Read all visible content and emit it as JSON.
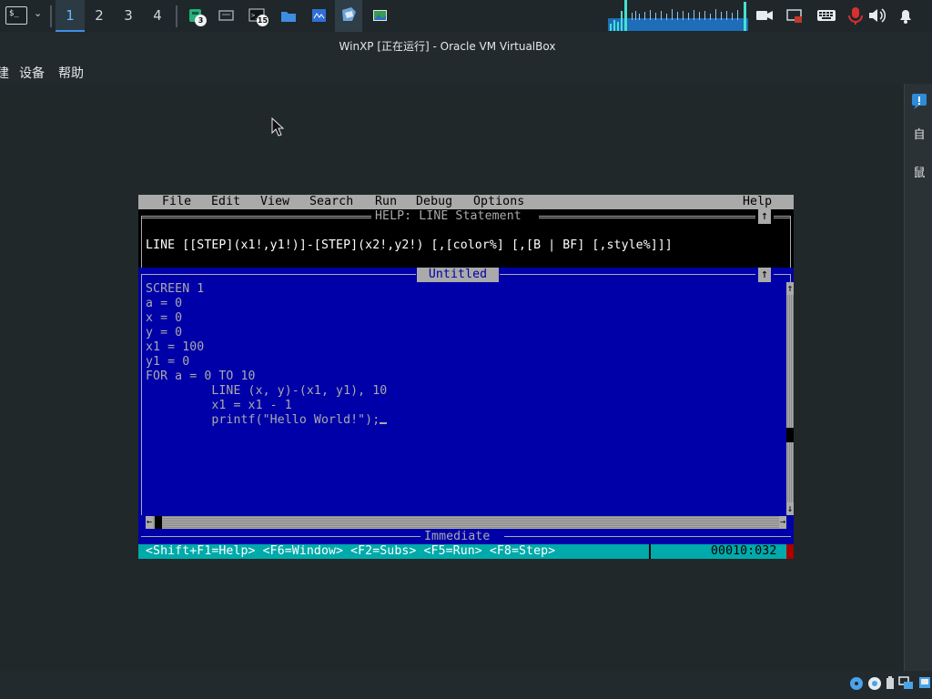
{
  "taskbar": {
    "workspaces": [
      "1",
      "2",
      "3",
      "4"
    ],
    "active_workspace": "1",
    "apps": [
      {
        "icon": "green-tool-icon",
        "badge": "3"
      },
      {
        "icon": "monitor-icon",
        "badge": ""
      },
      {
        "icon": "terminal-icon",
        "badge": "15"
      },
      {
        "icon": "folder-icon",
        "badge": ""
      },
      {
        "icon": "blue-window-icon",
        "badge": ""
      },
      {
        "icon": "virtualbox-icon",
        "badge": ""
      },
      {
        "icon": "image-viewer-icon",
        "badge": ""
      }
    ],
    "tray_icons": [
      "camera-icon",
      "screen-cast-icon",
      "keyboard-icon",
      "mic-muted-icon",
      "volume-icon",
      "bell-icon"
    ]
  },
  "vbox": {
    "window_title": "WinXP [正在运行] - Oracle VM VirtualBox",
    "menu": [
      "建",
      "设备",
      "帮助"
    ],
    "side_panel": [
      "自",
      "鼠"
    ]
  },
  "qbasic": {
    "menus": [
      "File",
      "Edit",
      "View",
      "Search",
      "Run",
      "Debug",
      "Options"
    ],
    "help_menu": "Help",
    "help_title": "HELP: LINE Statement",
    "help_syntax": "LINE [[STEP](x1!,y1!)]-[STEP](x2!,y2!) [,[color%] [,[B | BF] [,style%]]]",
    "editor_title": "Untitled",
    "code_lines": [
      "SCREEN 1",
      "a = 0",
      "x = 0",
      "y = 0",
      "x1 = 100",
      "y1 = 0",
      "FOR a = 0 TO 10",
      "         LINE (x, y)-(x1, y1), 10",
      "         x1 = x1 - 1",
      "         printf(\"Hello World!\");"
    ],
    "immediate_title": "Immediate",
    "status_hints": "<Shift+F1=Help> <F6=Window> <F2=Subs> <F5=Run> <F8=Step>",
    "cursor_position": "00010:032",
    "vscroll_arrows": [
      "↑",
      "↓"
    ],
    "hscroll_arrows": [
      "←",
      "→"
    ],
    "zoom_glyph": "↑"
  },
  "colors": {
    "qb_blue": "#0000a8",
    "qb_gray": "#aaaaaa",
    "qb_cyan": "#00aaaa",
    "desktop": "#222a2e"
  }
}
